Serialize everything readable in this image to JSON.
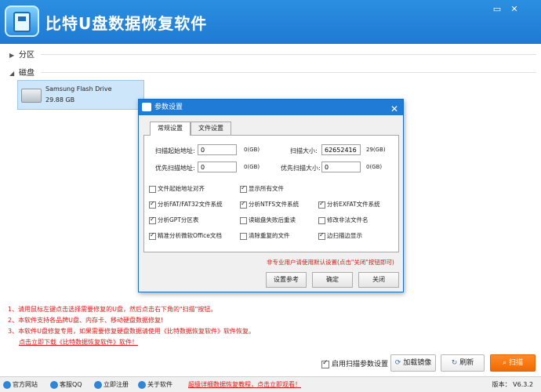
{
  "app": {
    "title": "比特U盘数据恢复软件"
  },
  "window_controls": {
    "minimize": "▭",
    "close": "✕"
  },
  "tree": {
    "partition_label": "分区",
    "disk_label": "磁盘",
    "drive": {
      "name": "Samsung Flash Drive",
      "size": "29.88 GB"
    }
  },
  "notes": [
    "1、请用鼠标左键点击选择需要修复的U盘，然后点击右下角的\"扫描\"按钮。",
    "2、本软件支持各品牌U盘、内存卡、移动硬盘数据修复!",
    "3、本软件U盘修复专用，如果需要修复硬盘数据请使用《比特数据恢复软件》软件恢复。",
    "点击立即下载《比特数据恢复软件》软件！"
  ],
  "actions": {
    "use_default_scan": "启用扫描参数设置",
    "load_image": "加载镜像",
    "refresh": "刷新",
    "scan": "扫描"
  },
  "statusbar": {
    "website": "官方网站",
    "qq": "客服QQ",
    "register": "立即注册",
    "about": "关于软件",
    "promo": "超级详细数据恢复教程，点击立即观看！",
    "version": "版本： V6.3.2"
  },
  "dialog": {
    "title": "参数设置",
    "close": "✕",
    "tabs": [
      "常规设置",
      "文件设置"
    ],
    "fields": {
      "scan_start_label": "扫描起始地址:",
      "scan_start_value": "0",
      "scan_start_unit": "0(GB)",
      "scan_size_label": "扫描大小:",
      "scan_size_value": "62652416",
      "scan_size_unit": "29(GB)",
      "prio_scan_label": "优先扫描地址:",
      "prio_scan_value": "0",
      "prio_scan_unit": "0(GB)",
      "prio_size_label": "优先扫描大小:",
      "prio_size_value": "0",
      "prio_size_unit": "0(GB)"
    },
    "options": [
      {
        "label": "文件起始地址对齐",
        "checked": false
      },
      {
        "label": "显示所有文件",
        "checked": true
      },
      {
        "label": "分析FAT/FAT32文件系统",
        "checked": true
      },
      {
        "label": "分析NTFS文件系统",
        "checked": true
      },
      {
        "label": "分析EXFAT文件系统",
        "checked": true
      },
      {
        "label": "分析GPT分区表",
        "checked": true
      },
      {
        "label": "读磁盘失败后重读",
        "checked": false
      },
      {
        "label": "修改非法文件名",
        "checked": false
      },
      {
        "label": "精准分析微软Office文档",
        "checked": true
      },
      {
        "label": "清除重复的文件",
        "checked": false
      },
      {
        "label": "边扫描边显示",
        "checked": true
      }
    ],
    "note": "非专业用户请使用默认设置(点击\"关闭\"按钮即可)",
    "buttons": {
      "reference": "设置参考",
      "ok": "确定",
      "close": "关闭"
    }
  }
}
